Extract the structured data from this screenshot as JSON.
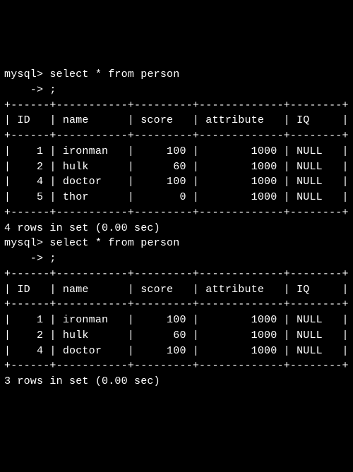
{
  "queries": [
    {
      "prompt1": "mysql> ",
      "cmd1": "select * from person",
      "prompt2": "    -> ",
      "cmd2": ";",
      "columns": [
        "ID",
        "name",
        "score",
        "attribute",
        "IQ"
      ],
      "widths": [
        4,
        9,
        7,
        11,
        6
      ],
      "align": [
        "right",
        "left",
        "right",
        "right",
        "left"
      ],
      "rows": [
        {
          "ID": "1",
          "name": "ironman",
          "score": "100",
          "attribute": "1000",
          "IQ": "NULL"
        },
        {
          "ID": "2",
          "name": "hulk",
          "score": "60",
          "attribute": "1000",
          "IQ": "NULL"
        },
        {
          "ID": "4",
          "name": "doctor",
          "score": "100",
          "attribute": "1000",
          "IQ": "NULL"
        },
        {
          "ID": "5",
          "name": "thor",
          "score": "0",
          "attribute": "1000",
          "IQ": "NULL"
        }
      ],
      "footer": "4 rows in set (0.00 sec)"
    },
    {
      "prompt1": "mysql> ",
      "cmd1": "select * from person",
      "prompt2": "    -> ",
      "cmd2": ";",
      "columns": [
        "ID",
        "name",
        "score",
        "attribute",
        "IQ"
      ],
      "widths": [
        4,
        9,
        7,
        11,
        6
      ],
      "align": [
        "right",
        "left",
        "right",
        "right",
        "left"
      ],
      "rows": [
        {
          "ID": "1",
          "name": "ironman",
          "score": "100",
          "attribute": "1000",
          "IQ": "NULL"
        },
        {
          "ID": "2",
          "name": "hulk",
          "score": "60",
          "attribute": "1000",
          "IQ": "NULL"
        },
        {
          "ID": "4",
          "name": "doctor",
          "score": "100",
          "attribute": "1000",
          "IQ": "NULL"
        }
      ],
      "footer": "3 rows in set (0.00 sec)"
    }
  ]
}
